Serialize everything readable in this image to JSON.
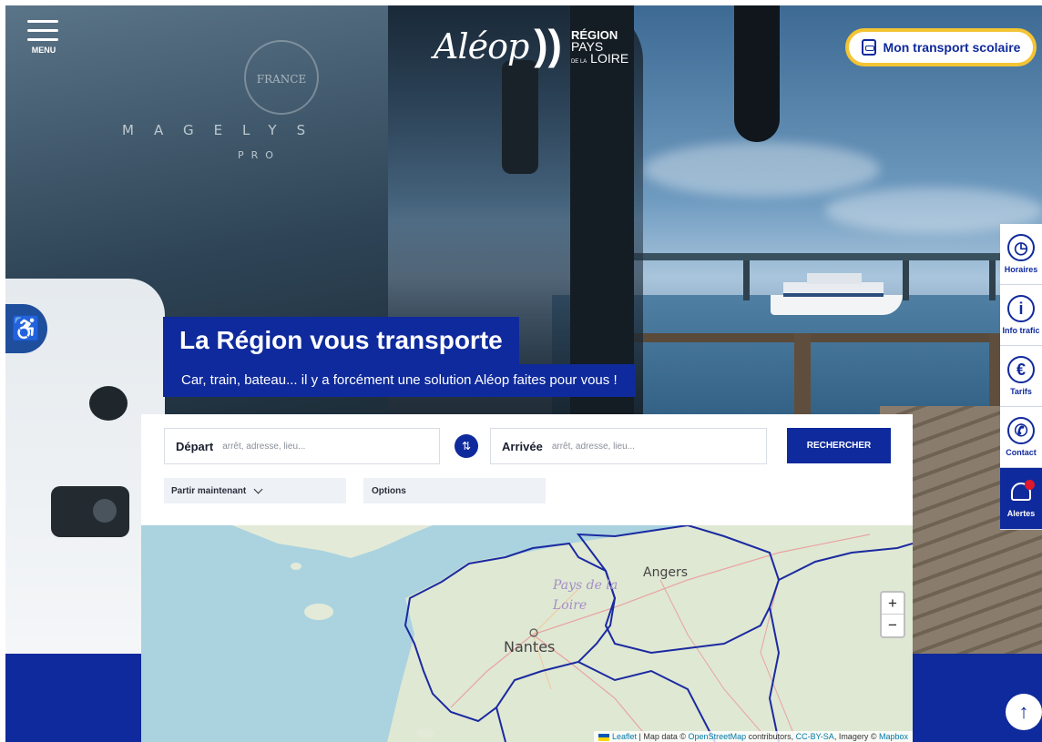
{
  "header": {
    "menu_label": "MENU",
    "logo_word": "Aléop",
    "logo_region": [
      "RÉGION",
      "PAYS",
      "LOIRE"
    ],
    "logo_de_la": "DE LA",
    "school_button": "Mon transport scolaire"
  },
  "hero": {
    "bus_model": "MAGELYS",
    "bus_model_sub": "PRO",
    "seal_text": "FRANCE",
    "title": "La Région vous transporte",
    "subtitle": "Car, train, bateau... il y a forcément une solution Aléop faites pour vous !"
  },
  "side_nav": [
    {
      "label": "Horaires",
      "icon": "clock-icon"
    },
    {
      "label": "Info trafic",
      "icon": "info-icon"
    },
    {
      "label": "Tarifs",
      "icon": "euro-icon"
    },
    {
      "label": "Contact",
      "icon": "phone-icon"
    },
    {
      "label": "Alertes",
      "icon": "bell-icon"
    }
  ],
  "search": {
    "depart_label": "Départ",
    "depart_placeholder": "arrêt, adresse, lieu...",
    "arrivee_label": "Arrivée",
    "arrivee_placeholder": "arrêt, adresse, lieu...",
    "submit_label": "RECHERCHER",
    "time_option": "Partir maintenant",
    "options_label": "Options"
  },
  "map": {
    "region_label": "Pays de la Loire",
    "cities": [
      "Angers",
      "Nantes"
    ],
    "zoom_in": "+",
    "zoom_out": "−",
    "attribution": {
      "leaflet": "Leaflet",
      "sep1": " | Map data © ",
      "osm": "OpenStreetMap",
      "sep2": " contributors, ",
      "license": "CC-BY-SA",
      "sep3": ", Imagery © ",
      "mapbox": "Mapbox"
    }
  },
  "scroll_top": "↑",
  "colors": {
    "brand_blue": "#0f2a9c",
    "accent_yellow": "#f3c433",
    "alert_red": "#e0182b"
  }
}
